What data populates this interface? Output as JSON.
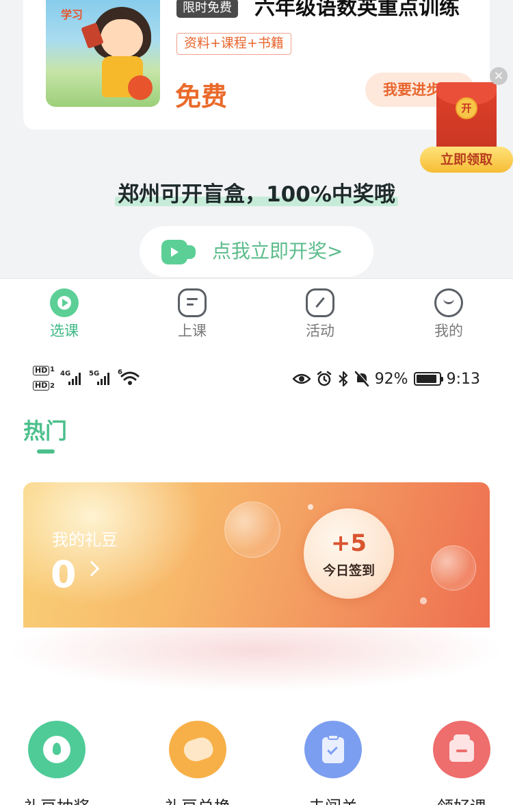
{
  "course": {
    "badge": "限时免费",
    "title": "六年级语数英重点训练",
    "tags": "资料+课程+书籍",
    "price": "免费",
    "enroll_label": "我要进步",
    "cover_tag": "学习"
  },
  "red_packet": {
    "coin_label": "开",
    "button_label": "立即领取",
    "close_label": "×"
  },
  "promo": {
    "text": "郑州可开盲盒，100%中奖哦",
    "button_label": "点我立即开奖>"
  },
  "tab_bar": {
    "tabs": [
      {
        "label": "选课",
        "icon": "play-icon",
        "active": true
      },
      {
        "label": "上课",
        "icon": "class-icon",
        "active": false
      },
      {
        "label": "活动",
        "icon": "activity-icon",
        "active": false
      },
      {
        "label": "我的",
        "icon": "profile-icon",
        "active": false
      }
    ],
    "active_color": "#3db886"
  },
  "status_bar": {
    "hd1": "HD",
    "hd1_sub": "1",
    "hd2": "HD",
    "hd2_sub": "2",
    "net1": "4G",
    "net2": "5G",
    "wifi_num": "6",
    "battery": "92%",
    "battery_level": 0.92,
    "time": "9:13"
  },
  "hot": {
    "heading": "热门",
    "accent": "#4cc08c"
  },
  "points": {
    "label": "我的礼豆",
    "value": "0",
    "checkin_value": "+5",
    "checkin_label": "今日签到"
  },
  "features": [
    {
      "label": "礼豆抽奖",
      "icon": "drop-icon",
      "color": "#4fcb98"
    },
    {
      "label": "礼豆兑换",
      "icon": "bean-icon",
      "color": "#f7b048"
    },
    {
      "label": "去闯关",
      "icon": "clipboard-icon",
      "color": "#7c9ef0"
    },
    {
      "label": "领好课",
      "icon": "gift-icon",
      "color": "#ee6d6d"
    }
  ]
}
